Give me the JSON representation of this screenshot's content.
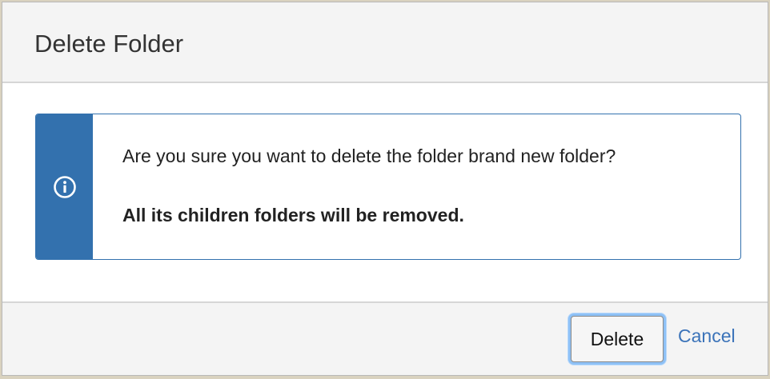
{
  "dialog": {
    "title": "Delete Folder",
    "alert": {
      "icon": "info-icon",
      "message": "Are you sure you want to delete the folder brand new folder?",
      "warning": "All its children folders will be removed."
    },
    "footer": {
      "delete_label": "Delete",
      "cancel_label": "Cancel"
    }
  },
  "colors": {
    "accent": "#3371ae",
    "link": "#3b73b9",
    "focus_ring": "#8ec1f6",
    "header_bg": "#f4f4f4"
  }
}
